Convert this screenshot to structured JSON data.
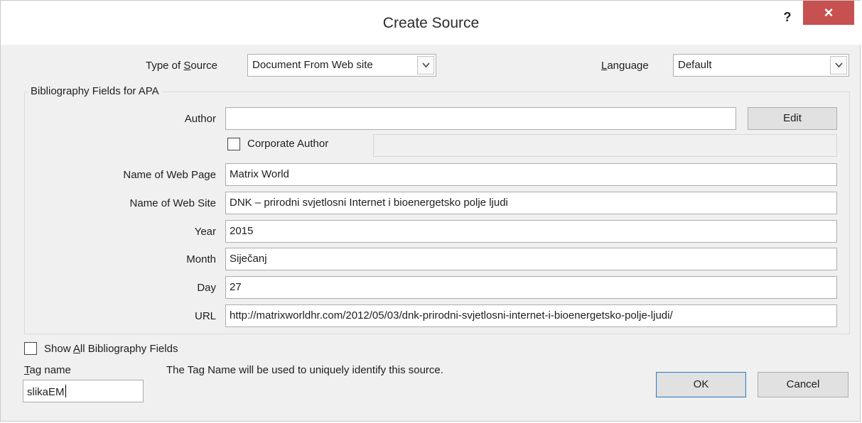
{
  "window": {
    "title": "Create Source",
    "help": "?",
    "close": "×"
  },
  "source_type": {
    "label_pre": "Type of ",
    "label_key": "S",
    "label_post": "ource",
    "value": "Document From Web site"
  },
  "language": {
    "label_key": "L",
    "label_post": "anguage",
    "value": "Default"
  },
  "group": {
    "label": "Bibliography Fields for APA"
  },
  "fields": {
    "author": {
      "label": "Author",
      "value": ""
    },
    "edit_button": "Edit",
    "corporate_author": {
      "label": "Corporate Author",
      "checked": false,
      "value": ""
    },
    "web_page": {
      "label": "Name of Web Page",
      "value": "Matrix World"
    },
    "web_site": {
      "label": "Name of Web Site",
      "value": "DNK – prirodni svjetlosni Internet i bioenergetsko polje ljudi"
    },
    "year": {
      "label": "Year",
      "value": "2015"
    },
    "month": {
      "label": "Month",
      "value": "Siječanj"
    },
    "day": {
      "label": "Day",
      "value": "27"
    },
    "url": {
      "label": "URL",
      "value": "http://matrixworldhr.com/2012/05/03/dnk-prirodni-svjetlosni-internet-i-bioenergetsko-polje-ljudi/"
    }
  },
  "show_all": {
    "label_pre": "Show ",
    "label_key": "A",
    "label_post": "ll Bibliography Fields",
    "checked": false
  },
  "tag": {
    "label_key": "T",
    "label_post": "ag name",
    "value": "slikaEM",
    "hint": "The Tag Name will be used to uniquely identify this source."
  },
  "buttons": {
    "ok": "OK",
    "cancel": "Cancel"
  },
  "colors": {
    "close_bg": "#c75050",
    "dialog_bg": "#f0f0f0",
    "default_border": "#3c7fb1"
  }
}
